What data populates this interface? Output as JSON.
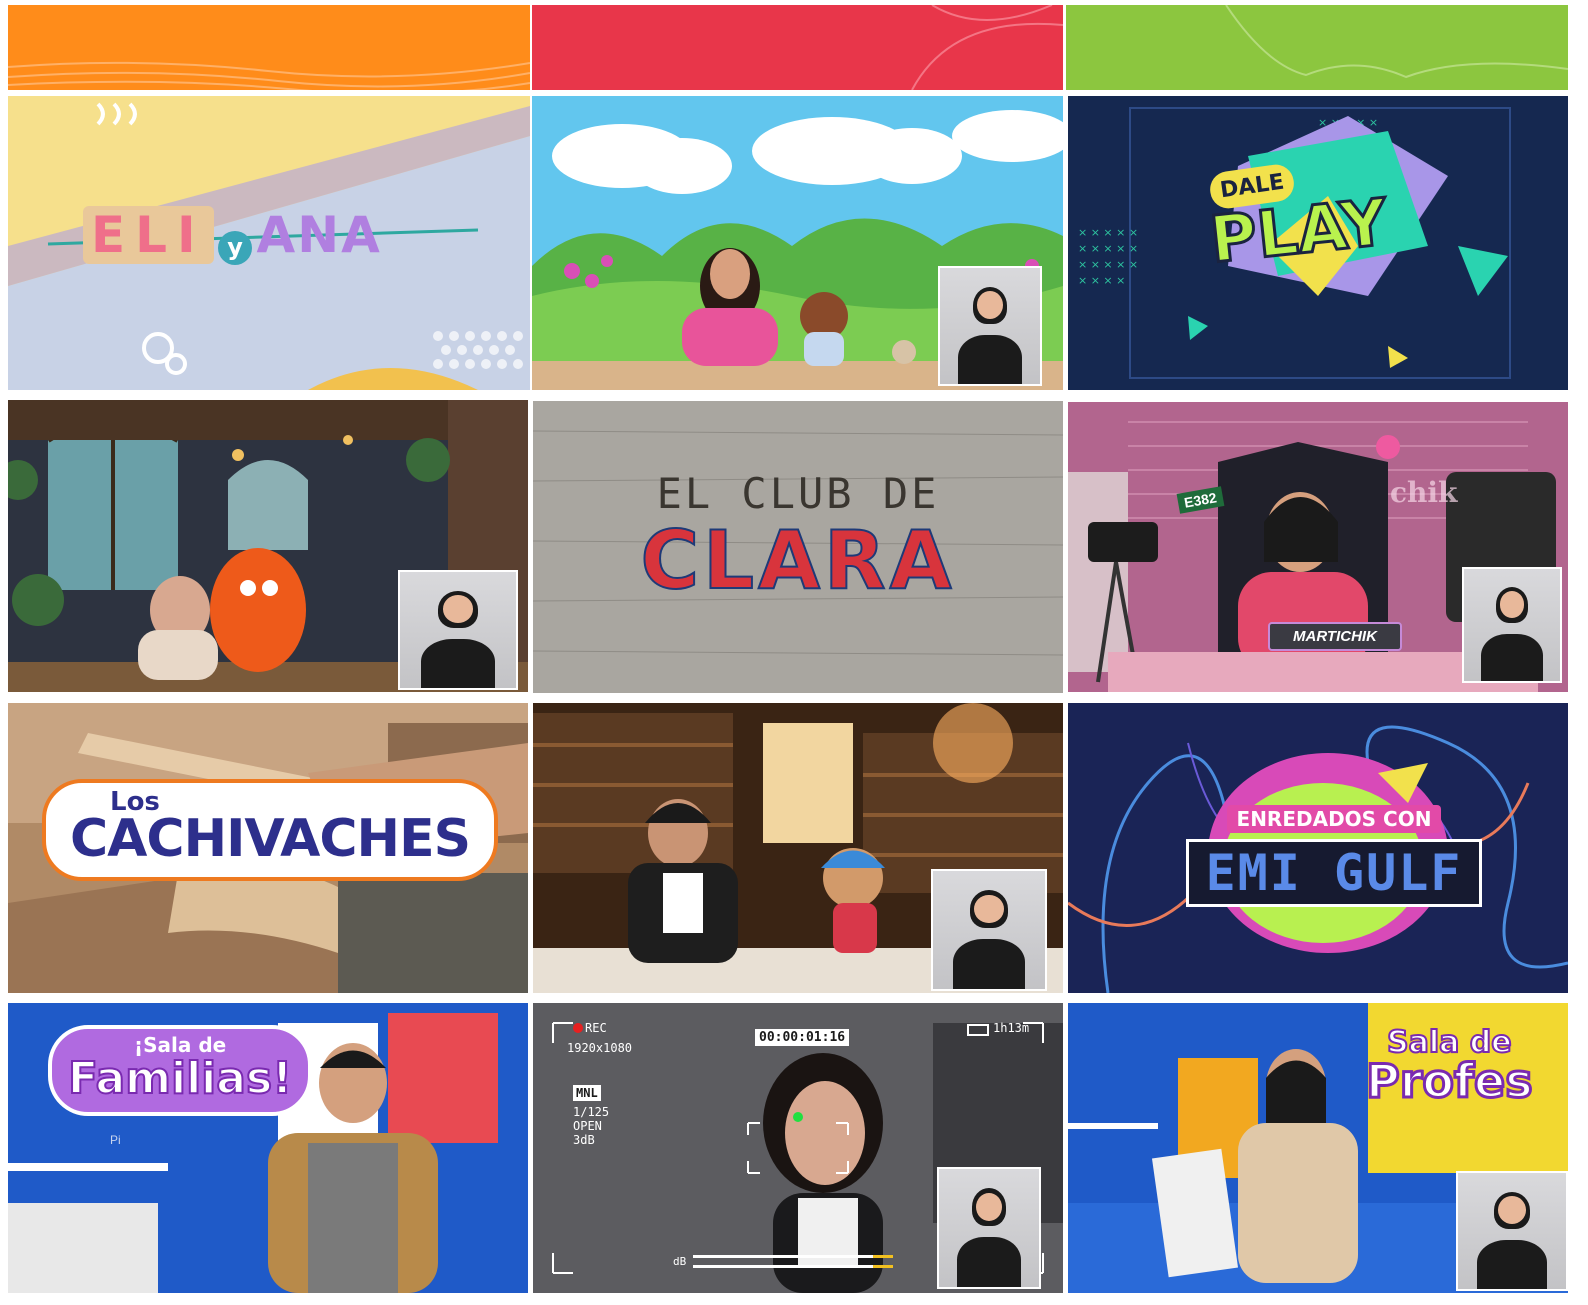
{
  "header_colors": [
    "#ff8c1a",
    "#e8364a",
    "#8cc63f"
  ],
  "tiles": [
    {
      "logo": [
        "ELI",
        "y",
        "ANA"
      ]
    },
    {
      "logo": []
    },
    {
      "logo": [
        "DALE",
        "PLAY"
      ]
    },
    {
      "logo": []
    },
    {
      "logo": [
        "EL CLUB DE",
        "CLARA"
      ]
    },
    {
      "logo": [
        "E382",
        "MARTICHIK",
        "chik"
      ]
    },
    {
      "logo": [
        "Los",
        "CACHIVACHES"
      ]
    },
    {
      "logo": []
    },
    {
      "logo": [
        "ENREDADOS CON",
        "EMI GULF"
      ]
    },
    {
      "logo": [
        "¡Sala de",
        "Familias!",
        "Pi"
      ]
    },
    {
      "logo": [],
      "hud": {
        "rec": "REC",
        "res": "1920x1080",
        "timecode": "00:00:01:16",
        "battery": "1h13m",
        "mode": "MNL",
        "shutter": "1/125",
        "iris": "OPEN",
        "gain": "3dB",
        "meter_label": "dB"
      }
    },
    {
      "logo": [
        "Sala de",
        "Profes"
      ]
    }
  ]
}
